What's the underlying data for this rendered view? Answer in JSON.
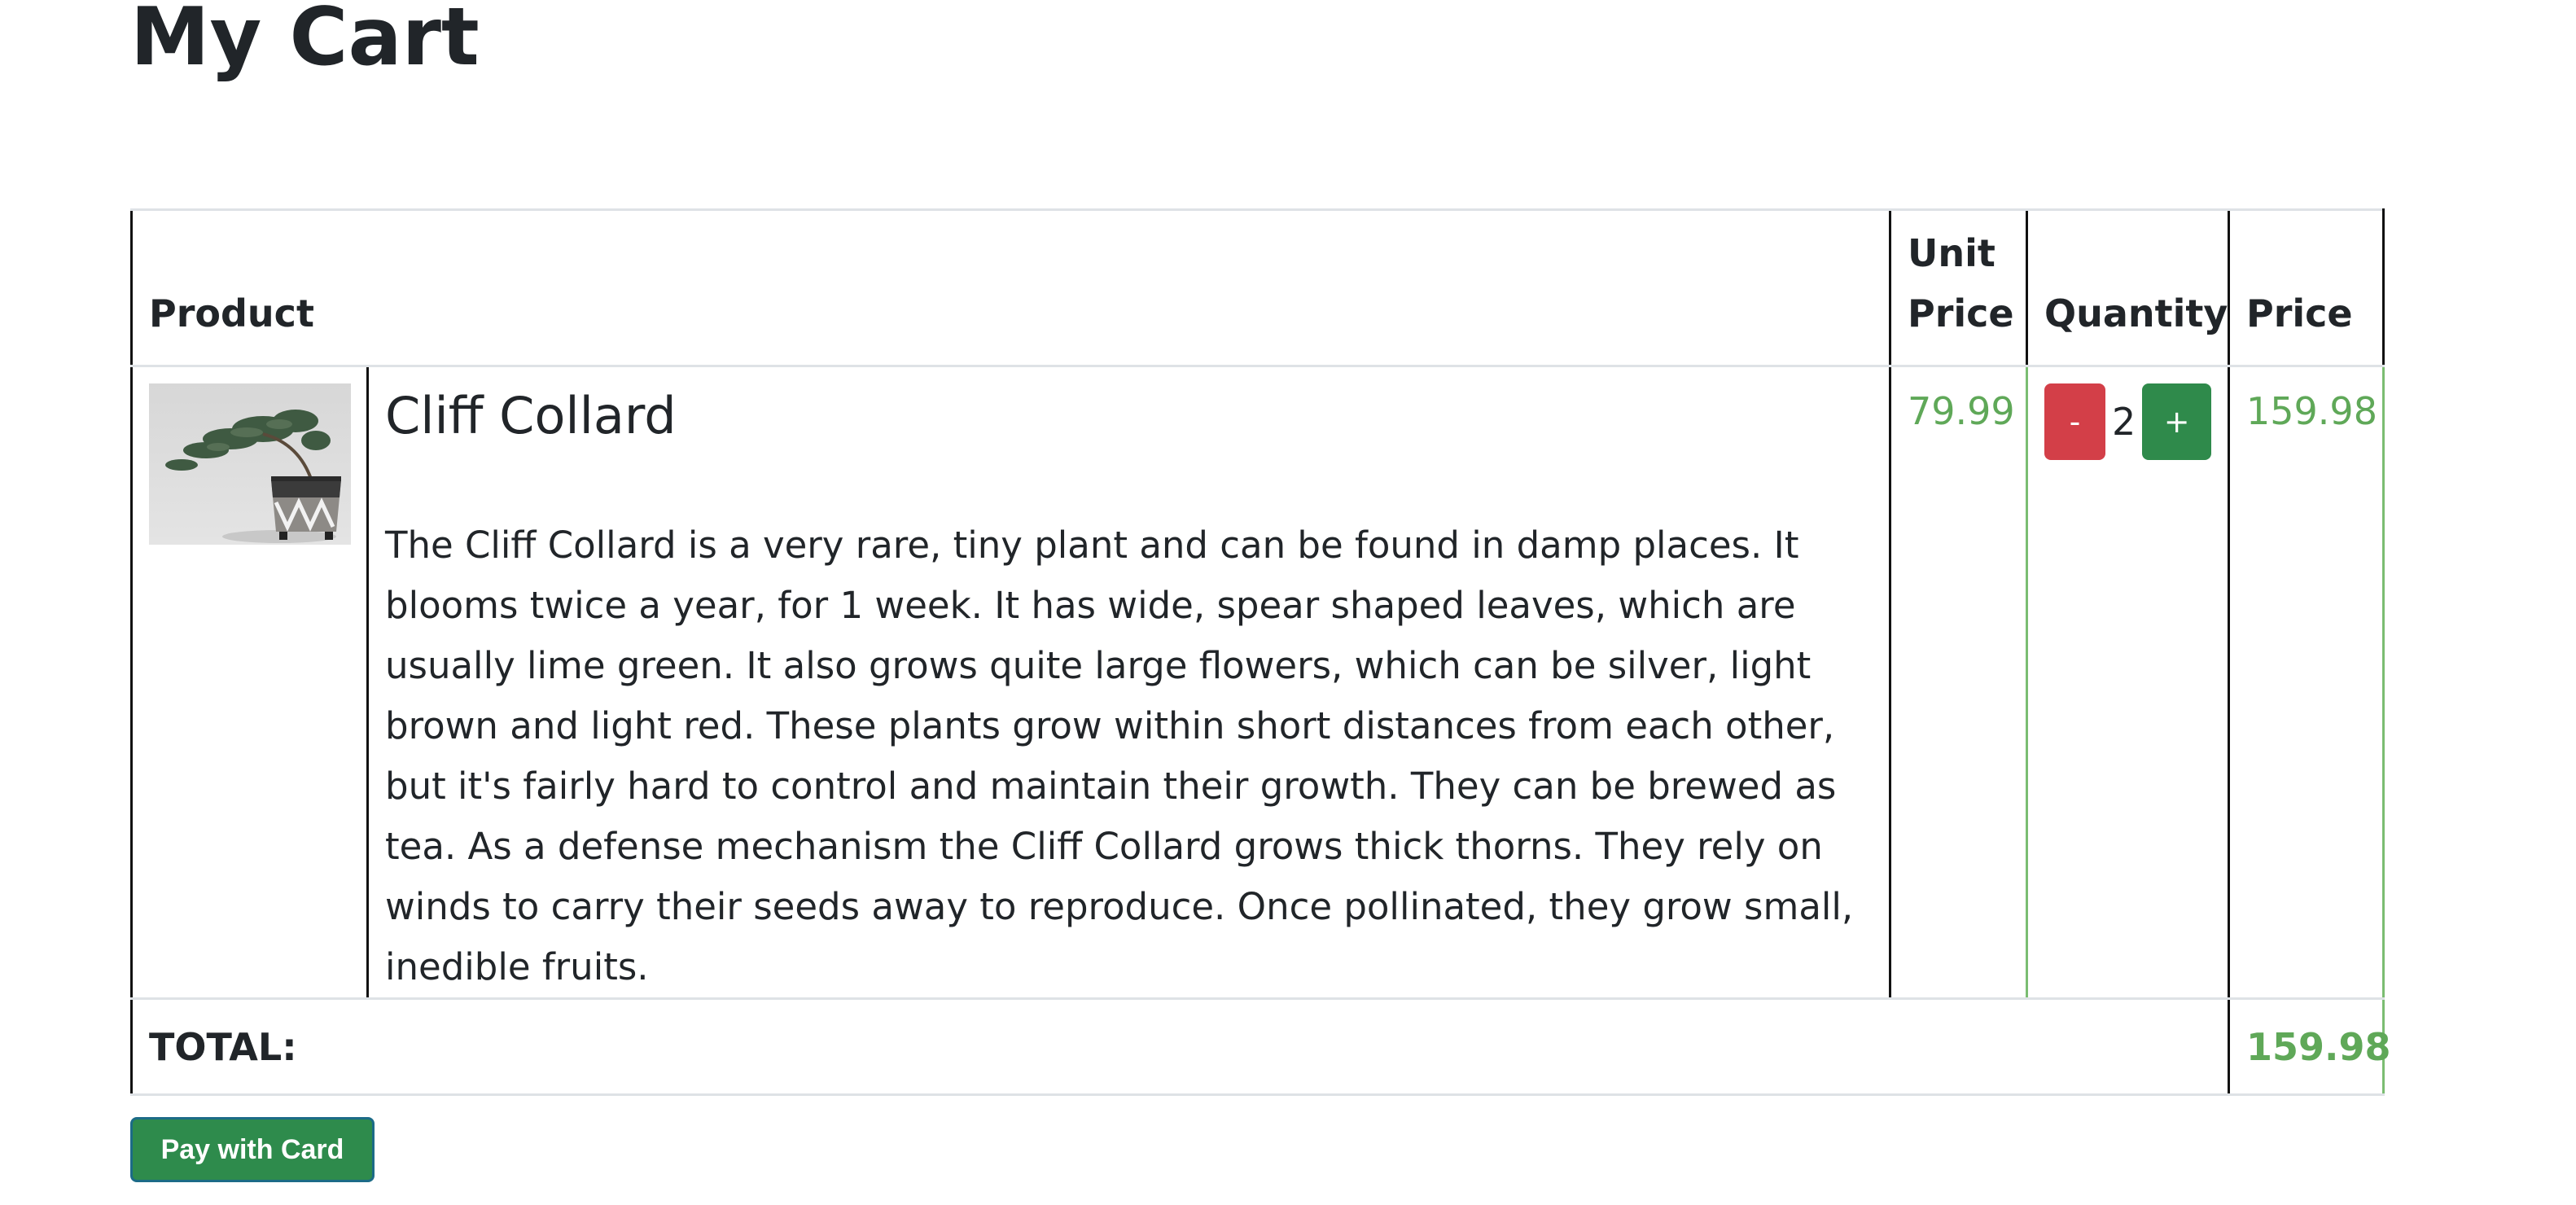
{
  "page": {
    "title": "My Cart"
  },
  "table": {
    "headers": {
      "product": "Product",
      "unit_price": "Unit Price",
      "quantity": "Quantity",
      "price": "Price"
    },
    "items": [
      {
        "image": "bonsai-plant-thumbnail",
        "name": "Cliff Collard",
        "description": "The Cliff Collard is a very rare, tiny plant and can be found in damp places. It blooms twice a year, for 1 week. It has wide, spear shaped leaves, which are usually lime green. It also grows quite large flowers, which can be silver, light brown and light red. These plants grow within short distances from each other, but it's fairly hard to control and maintain their growth. They can be brewed as tea. As a defense mechanism the Cliff Collard grows thick thorns. They rely on winds to carry their seeds away to reproduce. Once pollinated, they grow small, inedible fruits.",
        "unit_price": "79.99",
        "quantity": "2",
        "decrement_label": "-",
        "increment_label": "+",
        "price": "159.98"
      }
    ],
    "total": {
      "label": "TOTAL:",
      "value": "159.98"
    }
  },
  "actions": {
    "pay_label": "Pay with Card"
  },
  "colors": {
    "price_green": "#5fa858",
    "minus_red": "#d33f48",
    "plus_green": "#2f8a4b",
    "pay_green": "#2e8b4c"
  }
}
